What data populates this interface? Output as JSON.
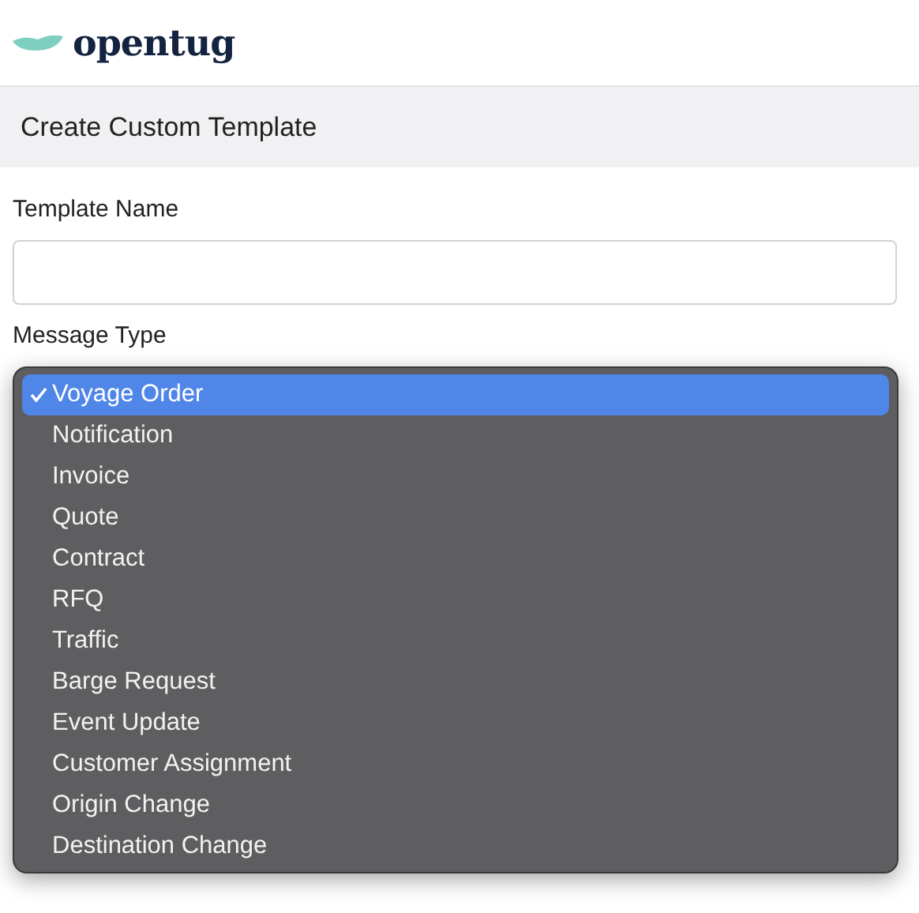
{
  "header": {
    "logo_text": "opentug"
  },
  "section": {
    "title": "Create Custom Template"
  },
  "form": {
    "template_name": {
      "label": "Template Name"
    },
    "message_type": {
      "label": "Message Type"
    }
  },
  "message_type_menu": {
    "options": [
      {
        "label": "Voyage Order",
        "selected": true
      },
      {
        "label": "Notification",
        "selected": false
      },
      {
        "label": "Invoice",
        "selected": false
      },
      {
        "label": "Quote",
        "selected": false
      },
      {
        "label": "Contract",
        "selected": false
      },
      {
        "label": "RFQ",
        "selected": false
      },
      {
        "label": "Traffic",
        "selected": false
      },
      {
        "label": "Barge Request",
        "selected": false
      },
      {
        "label": "Event Update",
        "selected": false
      },
      {
        "label": "Customer Assignment",
        "selected": false
      },
      {
        "label": "Origin Change",
        "selected": false
      },
      {
        "label": "Destination Change",
        "selected": false
      }
    ]
  }
}
